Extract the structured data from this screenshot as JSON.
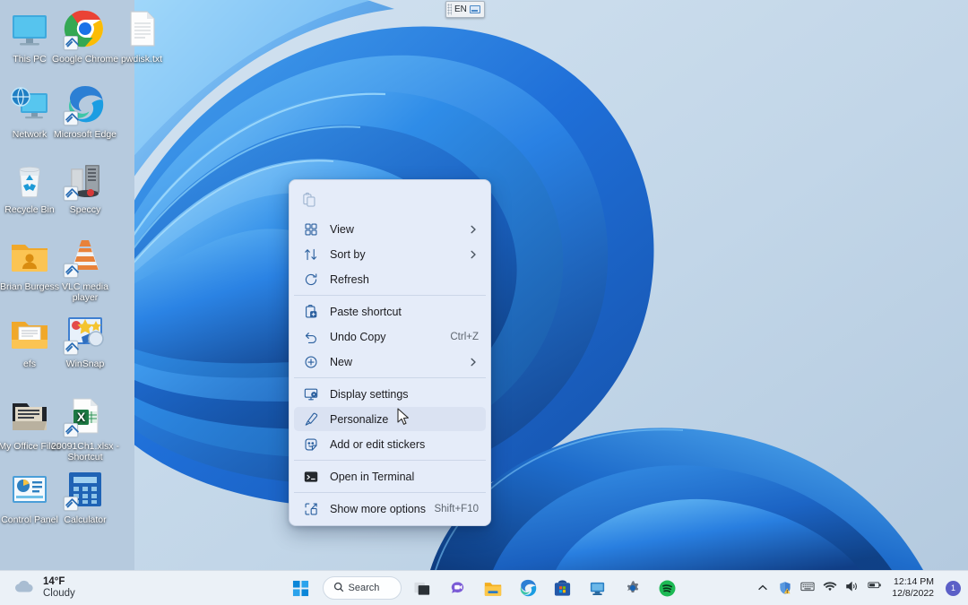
{
  "desktop": {
    "background_color": "#b6cade",
    "wallpaper_name": "windows-11-bloom-wallpaper",
    "icons": [
      {
        "label": "This PC",
        "art": "this-pc",
        "shortcut": false
      },
      {
        "label": "Google Chrome",
        "art": "google-chrome",
        "shortcut": true
      },
      {
        "label": "pwdisk.txt",
        "art": "text-file",
        "shortcut": false
      },
      {
        "label": "Network",
        "art": "network",
        "shortcut": false
      },
      {
        "label": "Microsoft Edge",
        "art": "microsoft-edge",
        "shortcut": true
      },
      {
        "label": "Recycle Bin",
        "art": "recycle-bin",
        "shortcut": false
      },
      {
        "label": "Speccy",
        "art": "speccy",
        "shortcut": true
      },
      {
        "label": "Brian Burgess",
        "art": "user-folder",
        "shortcut": false
      },
      {
        "label": "VLC media player",
        "art": "vlc",
        "shortcut": true
      },
      {
        "label": "efs",
        "art": "document-folder",
        "shortcut": false
      },
      {
        "label": "WinSnap",
        "art": "winsnap",
        "shortcut": true
      },
      {
        "label": "My Office Files",
        "art": "office-folder",
        "shortcut": false
      },
      {
        "label": "20091Ch1.xlsx - Shortcut",
        "art": "excel-file",
        "shortcut": true
      },
      {
        "label": "Control Panel",
        "art": "control-panel",
        "shortcut": false
      },
      {
        "label": "Calculator",
        "art": "calculator",
        "shortcut": true
      }
    ]
  },
  "language_bar": {
    "language": "EN",
    "keyboard_icon": "keyboard-icon"
  },
  "context_menu": {
    "header_icon": "paste-clipboard-icon",
    "items": [
      {
        "label": "View",
        "icon": "grid-view-icon",
        "accel": "",
        "submenu": true,
        "highlighted": false,
        "separator_after": false
      },
      {
        "label": "Sort by",
        "icon": "sort-arrows-icon",
        "accel": "",
        "submenu": true,
        "highlighted": false,
        "separator_after": false
      },
      {
        "label": "Refresh",
        "icon": "refresh-icon",
        "accel": "",
        "submenu": false,
        "highlighted": false,
        "separator_after": true
      },
      {
        "label": "Paste shortcut",
        "icon": "paste-shortcut-icon",
        "accel": "",
        "submenu": false,
        "highlighted": false,
        "separator_after": false
      },
      {
        "label": "Undo Copy",
        "icon": "undo-icon",
        "accel": "Ctrl+Z",
        "submenu": false,
        "highlighted": false,
        "separator_after": false
      },
      {
        "label": "New",
        "icon": "plus-circle-icon",
        "accel": "",
        "submenu": true,
        "highlighted": false,
        "separator_after": true
      },
      {
        "label": "Display settings",
        "icon": "display-settings-icon",
        "accel": "",
        "submenu": false,
        "highlighted": false,
        "separator_after": false
      },
      {
        "label": "Personalize",
        "icon": "paintbrush-icon",
        "accel": "",
        "submenu": false,
        "highlighted": true,
        "separator_after": false
      },
      {
        "label": "Add or edit stickers",
        "icon": "sticker-icon",
        "accel": "",
        "submenu": false,
        "highlighted": false,
        "separator_after": true
      },
      {
        "label": "Open in Terminal",
        "icon": "terminal-icon",
        "accel": "",
        "submenu": false,
        "highlighted": false,
        "separator_after": true
      },
      {
        "label": "Show more options",
        "icon": "more-options-icon",
        "accel": "Shift+F10",
        "submenu": false,
        "highlighted": false,
        "separator_after": false
      }
    ]
  },
  "taskbar": {
    "weather": {
      "icon": "cloud-icon",
      "temperature": "14°F",
      "condition": "Cloudy"
    },
    "start_button": "start-button",
    "search": {
      "icon": "search-icon",
      "label": "Search"
    },
    "apps": [
      {
        "name": "task-view",
        "label": "Task View"
      },
      {
        "name": "chat",
        "label": "Chat"
      },
      {
        "name": "file-explorer",
        "label": "File Explorer"
      },
      {
        "name": "microsoft-edge",
        "label": "Microsoft Edge"
      },
      {
        "name": "microsoft-store",
        "label": "Microsoft Store"
      },
      {
        "name": "remote-desktop",
        "label": "Remote Desktop"
      },
      {
        "name": "settings",
        "label": "Settings"
      },
      {
        "name": "spotify",
        "label": "Spotify"
      }
    ],
    "tray": {
      "chevron": "show-hidden-icons-icon",
      "icons": [
        {
          "name": "security-warning-icon"
        },
        {
          "name": "touch-keyboard-icon"
        },
        {
          "name": "wifi-icon"
        },
        {
          "name": "volume-icon"
        },
        {
          "name": "battery-icon"
        }
      ],
      "time": "12:14 PM",
      "date": "12/8/2022",
      "notification_count": "1"
    }
  },
  "colors": {
    "accent": "#3a79c8",
    "menu_bg": "#e5ecf9",
    "menu_highlight": "#dae2f2",
    "taskbar_bg": "#eef3f9",
    "icon_blue": "#2a5f9e"
  }
}
